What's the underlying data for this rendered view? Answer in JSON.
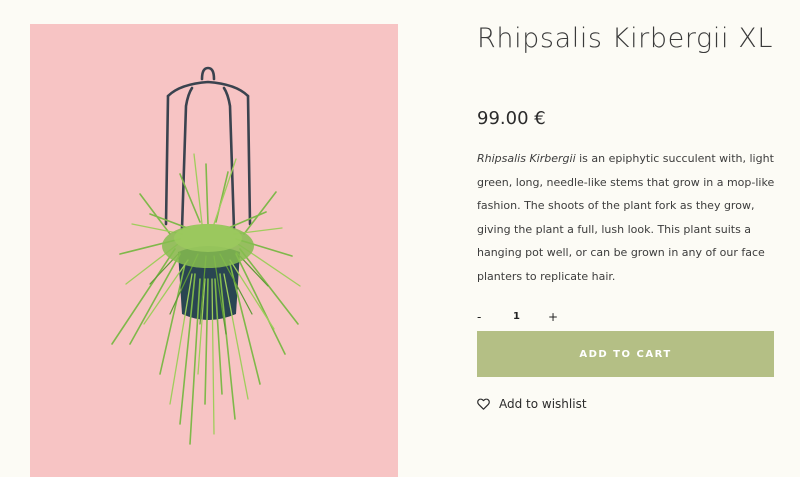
{
  "product": {
    "title": "Rhipsalis Kirbergii XL",
    "price": "99.00 €",
    "description_italic": "Rhipsalis Kirbergii",
    "description_rest": " is an epiphytic succulent with, light green, long, needle-like stems that grow in a mop-like fashion. The shoots of the plant fork as they grow, giving the plant a full, lush look. This plant suits a hanging pot well, or can be grown in any of our face planters to replicate hair.",
    "image_background": "#f7c4c4",
    "image_alt": ""
  },
  "quantity": {
    "decrement_label": "-",
    "value": "1",
    "increment_label": "+"
  },
  "cart": {
    "button_label": "ADD TO CART",
    "button_color": "#b4bf85"
  },
  "wishlist": {
    "icon": "heart-icon",
    "label": "Add to wishlist"
  }
}
